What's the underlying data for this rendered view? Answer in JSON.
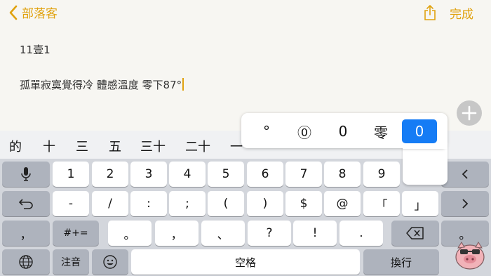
{
  "nav": {
    "back_label": "部落客",
    "done_label": "完成",
    "accent": "#e0a20f"
  },
  "note": {
    "line1": "11壹1",
    "line2": "孤單寂寞覺得冷 體感溫度 零下87°"
  },
  "candidates": [
    "的",
    "十",
    "三",
    "五",
    "三十",
    "二十",
    "一"
  ],
  "popup": {
    "variants": [
      "°",
      "⓪",
      "0",
      "零",
      "0"
    ],
    "selected_index": 4,
    "selected_color": "#157cf5"
  },
  "keyboard": {
    "row1": [
      "1",
      "2",
      "3",
      "4",
      "5",
      "6",
      "7",
      "8",
      "9"
    ],
    "row2": [
      "-",
      "/",
      ":",
      ";",
      "(",
      ")",
      "$",
      "@",
      "「",
      "」"
    ],
    "row3": [
      "。",
      "，",
      "、",
      "?",
      "!",
      "."
    ],
    "left_comma": "，",
    "symbols_toggle": "#+=",
    "right_period": "。",
    "zhuyin_label": "注音",
    "space_label": "空格",
    "return_label": "換行"
  }
}
